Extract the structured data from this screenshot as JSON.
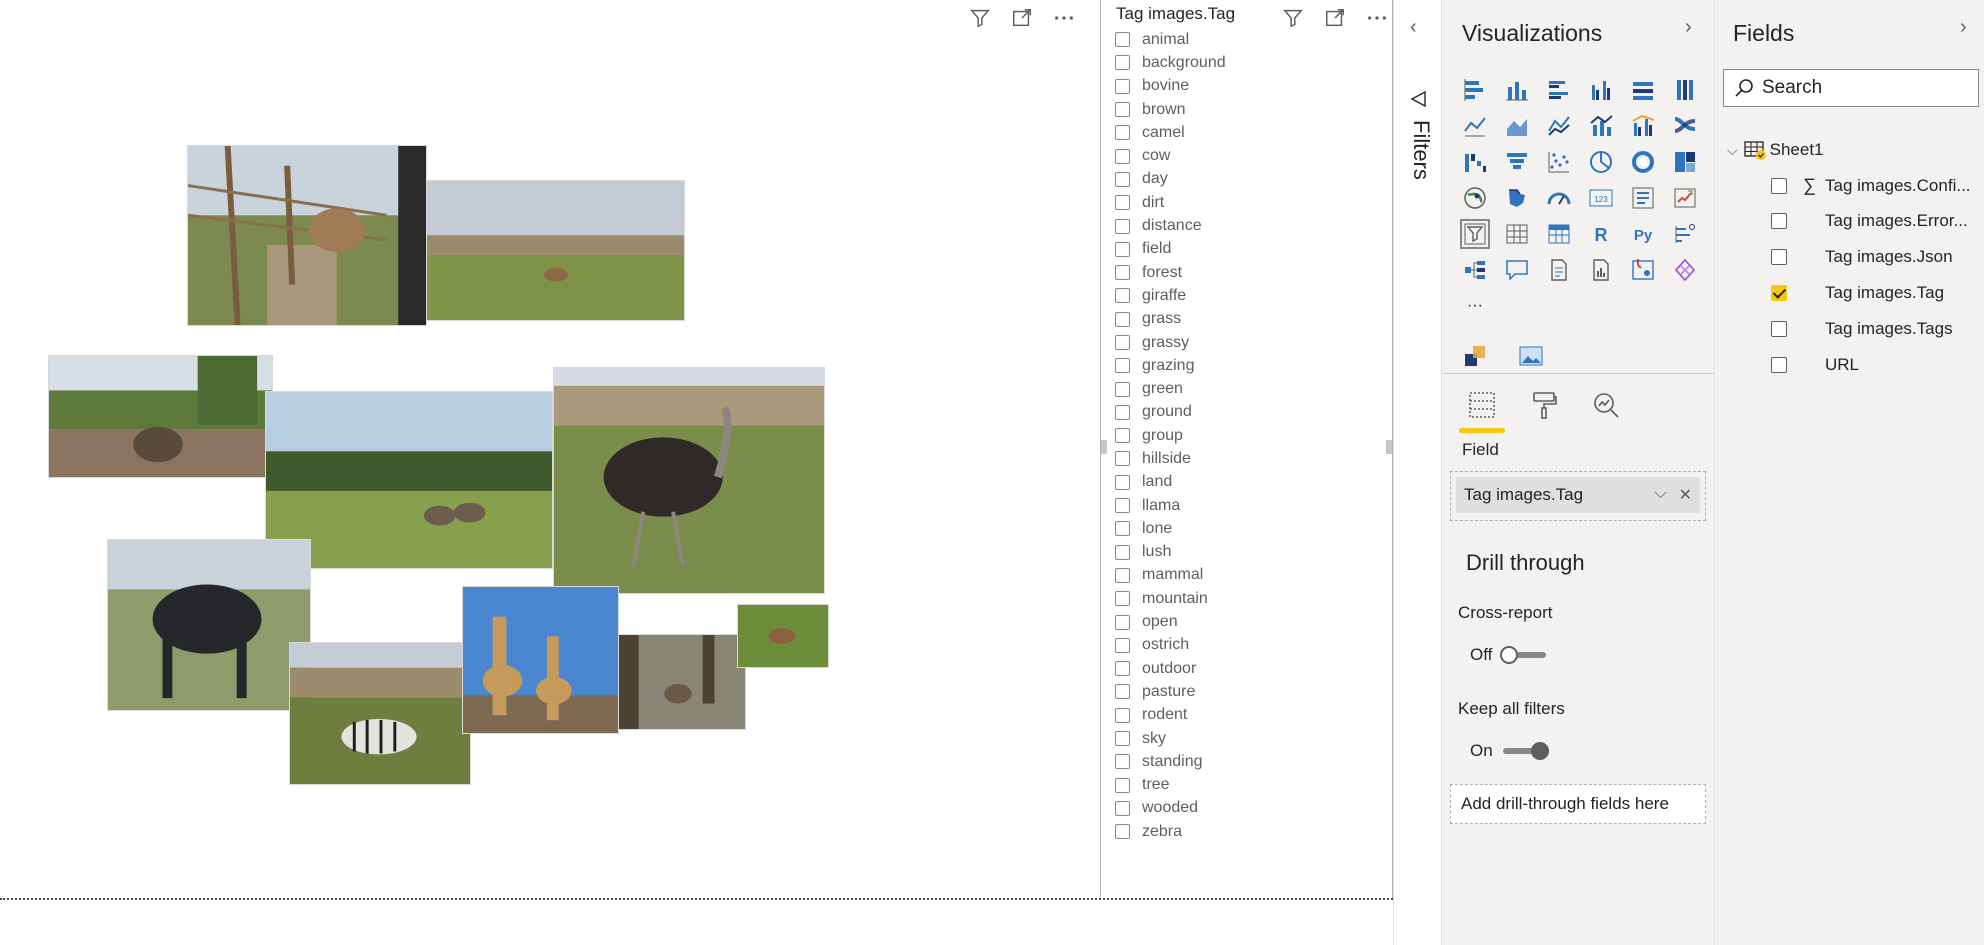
{
  "slicer": {
    "title": "Tag images.Tag",
    "items": [
      "animal",
      "background",
      "bovine",
      "brown",
      "camel",
      "cow",
      "day",
      "dirt",
      "distance",
      "field",
      "forest",
      "giraffe",
      "grass",
      "grassy",
      "grazing",
      "green",
      "ground",
      "group",
      "hillside",
      "land",
      "llama",
      "lone",
      "lush",
      "mammal",
      "mountain",
      "open",
      "ostrich",
      "outdoor",
      "pasture",
      "rodent",
      "sky",
      "standing",
      "tree",
      "wooded",
      "zebra"
    ]
  },
  "filters": {
    "label": "Filters"
  },
  "visualizations": {
    "title": "Visualizations",
    "icons": [
      "stacked-bar",
      "stacked-column",
      "clustered-bar",
      "clustered-column",
      "100-bar",
      "100-column",
      "line",
      "area",
      "stacked-area",
      "line-column",
      "line-clustered",
      "ribbon",
      "waterfall",
      "funnel",
      "scatter",
      "pie",
      "donut",
      "treemap",
      "map",
      "filled-map",
      "gauge",
      "card",
      "multirow-card",
      "kpi",
      "slicer",
      "table",
      "matrix",
      "r-visual",
      "python-visual",
      "key-influencers",
      "decomposition-tree",
      "qa",
      "smart-narrative",
      "paginated-report",
      "power-apps",
      "power-automate",
      "more"
    ],
    "r_label": "R",
    "py_label": "Py",
    "card_label": "123",
    "more_label": "···",
    "field_label": "Field",
    "field_value": "Tag images.Tag",
    "drill_title": "Drill through",
    "cross_report": "Cross-report",
    "off_label": "Off",
    "keep_filters": "Keep all filters",
    "on_label": "On",
    "add_drill": "Add drill-through fields here"
  },
  "fields": {
    "title": "Fields",
    "search_placeholder": "Search",
    "table_name": "Sheet1",
    "items": [
      {
        "label": "Tag images.Confi...",
        "checked": false,
        "sigma": true
      },
      {
        "label": "Tag images.Error...",
        "checked": false,
        "sigma": false
      },
      {
        "label": "Tag images.Json",
        "checked": false,
        "sigma": false
      },
      {
        "label": "Tag images.Tag",
        "checked": true,
        "sigma": false
      },
      {
        "label": "Tag images.Tags",
        "checked": false,
        "sigma": false
      },
      {
        "label": "URL",
        "checked": false,
        "sigma": false
      }
    ]
  },
  "colors": {
    "accent": "#f2c811",
    "pane_bg": "#f3f2f1",
    "text": "#252423"
  }
}
